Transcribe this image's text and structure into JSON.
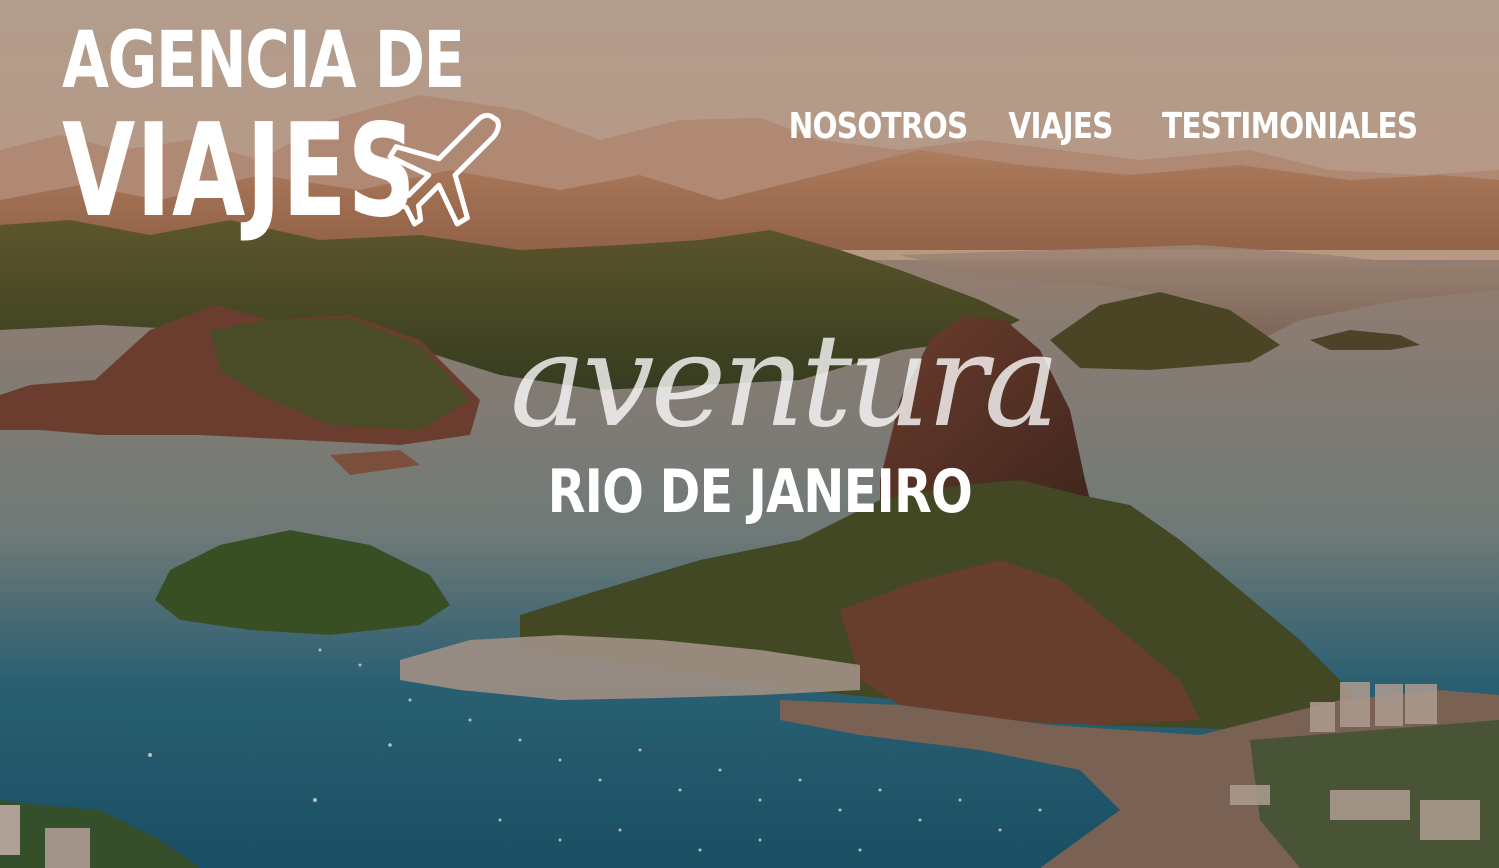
{
  "logo": {
    "line1": "AGENCIA DE",
    "line2": "VIAJES",
    "icon": "airplane-icon"
  },
  "nav": {
    "items": [
      {
        "label": "NOSOTROS"
      },
      {
        "label": "VIAJES"
      },
      {
        "label": "TESTIMONIALES"
      }
    ]
  },
  "hero": {
    "tagline": "aventura",
    "destination": "RIO DE JANEIRO"
  },
  "colors": {
    "text": "#ffffff",
    "sky": "#d9b49a",
    "water": "#2b6f85",
    "mountain": "#6b5a2e"
  }
}
